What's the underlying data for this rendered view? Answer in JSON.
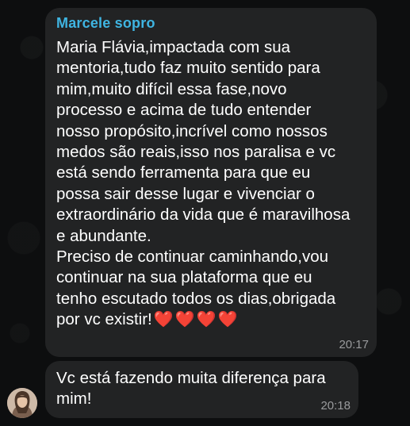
{
  "messages": [
    {
      "sender": "Marcele sopro",
      "text": "Maria Flávia,impactada com sua\nmentoria,tudo faz muito  sentido para\nmim,muito difícil essa fase,novo\nprocesso e acima de tudo entender\nnosso propósito,incrível como nossos\nmedos são reais,isso nos paralisa e vc\nestá sendo ferramenta para que eu\npossa sair desse lugar e vivenciar o\nextraordinário da vida que é maravilhosa\ne abundante.\nPreciso de continuar caminhando,vou\ncontinuar na sua plataforma que eu\ntenho escutado todos os dias,obrigada\npor vc existir!",
      "emoji": "❤️❤️❤️❤️",
      "time": "20:17"
    },
    {
      "text": "Vc está fazendo muita diferença para\nmim!",
      "time": "20:18"
    }
  ],
  "colors": {
    "background": "#0d0e0f",
    "bubble": "#222324",
    "sender_name": "#3fb5e2",
    "timestamp": "#9a9b9d",
    "heart": "#e8212e"
  },
  "icons": {
    "avatar": "profile-photo"
  }
}
